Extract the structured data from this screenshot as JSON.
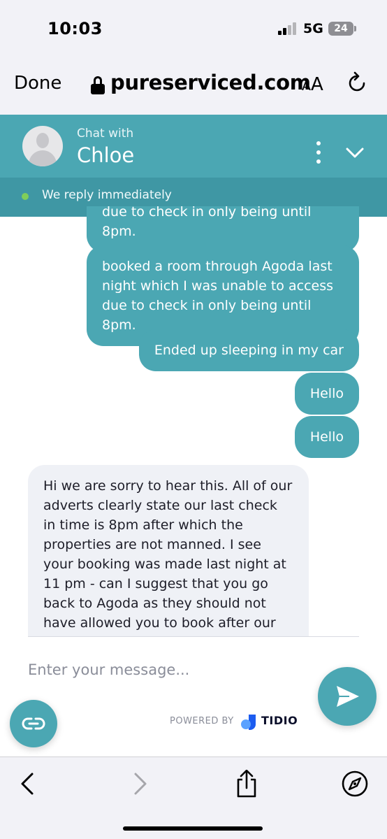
{
  "status_bar": {
    "time": "10:03",
    "network": "5G",
    "battery": "24"
  },
  "browser": {
    "done_label": "Done",
    "url": "pureserviced.com",
    "text_size_label_small": "A",
    "text_size_label_large": "A"
  },
  "chat_header": {
    "title_prefix": "Chat with",
    "agent_name": "Chloe",
    "status_text": "We reply immediately"
  },
  "messages": [
    {
      "from": "visitor",
      "text": "due to check in only being until 8pm."
    },
    {
      "from": "visitor",
      "text": "booked a room through Agoda last night which I was unable to access due to check in only being until 8pm."
    },
    {
      "from": "visitor",
      "text": "Ended up sleeping in my car"
    },
    {
      "from": "visitor",
      "text": "Hello"
    },
    {
      "from": "visitor",
      "text": "Hello"
    },
    {
      "from": "agent",
      "text": "Hi we are sorry to hear this. All of our adverts clearly state our last check in time is 8pm after which the properties are not manned. I see your booking was made last night at 11 pm - can I suggest that you go back to Agoda as they should not have allowed you to book after our reception had closed"
    }
  ],
  "composer": {
    "placeholder": "Enter your message...",
    "powered_by": "POWERED BY",
    "brand": "TIDIO"
  },
  "colors": {
    "accent": "#4ba7b3",
    "accent_dark": "#3f97a4",
    "agent_bubble": "#eff1f6",
    "online": "#7fce5a"
  },
  "icons": [
    "lock-icon",
    "reload-icon",
    "more-options-icon",
    "chevron-down-icon",
    "send-icon",
    "chat-launcher-icon",
    "back-icon",
    "forward-icon",
    "share-icon",
    "compass-icon"
  ]
}
